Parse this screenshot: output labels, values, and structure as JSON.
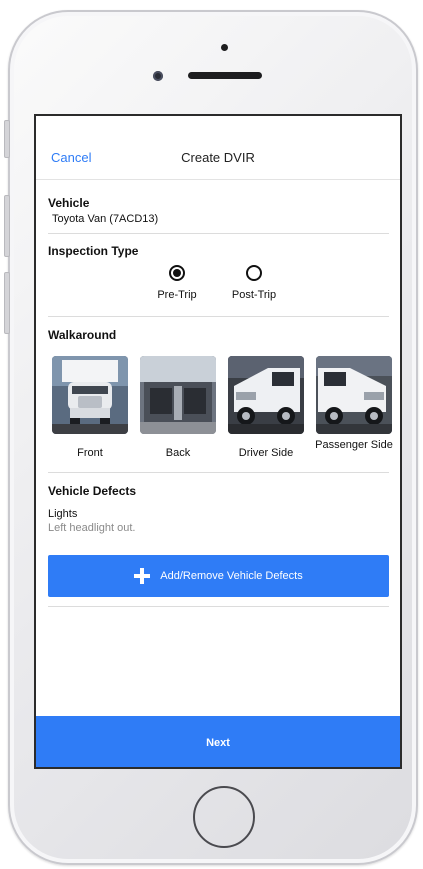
{
  "nav": {
    "cancel_label": "Cancel",
    "title": "Create DVIR"
  },
  "vehicle": {
    "label": "Vehicle",
    "value": "Toyota Van (7ACD13)"
  },
  "inspection": {
    "label": "Inspection Type",
    "options": [
      {
        "label": "Pre-Trip",
        "selected": true
      },
      {
        "label": "Post-Trip",
        "selected": false
      }
    ]
  },
  "walkaround": {
    "label": "Walkaround",
    "photos": [
      {
        "label": "Front",
        "icon": "truck-front-photo"
      },
      {
        "label": "Back",
        "icon": "truck-back-photo"
      },
      {
        "label": "Driver Side",
        "icon": "truck-driver-side-photo"
      },
      {
        "label": "Passenger Side",
        "icon": "truck-passenger-side-photo"
      }
    ]
  },
  "defects": {
    "label": "Vehicle Defects",
    "items": [
      {
        "name": "Lights",
        "note": "Left headlight out."
      }
    ],
    "add_button_label": "Add/Remove Vehicle Defects"
  },
  "footer": {
    "next_label": "Next"
  },
  "colors": {
    "accent": "#2f7cf6"
  }
}
